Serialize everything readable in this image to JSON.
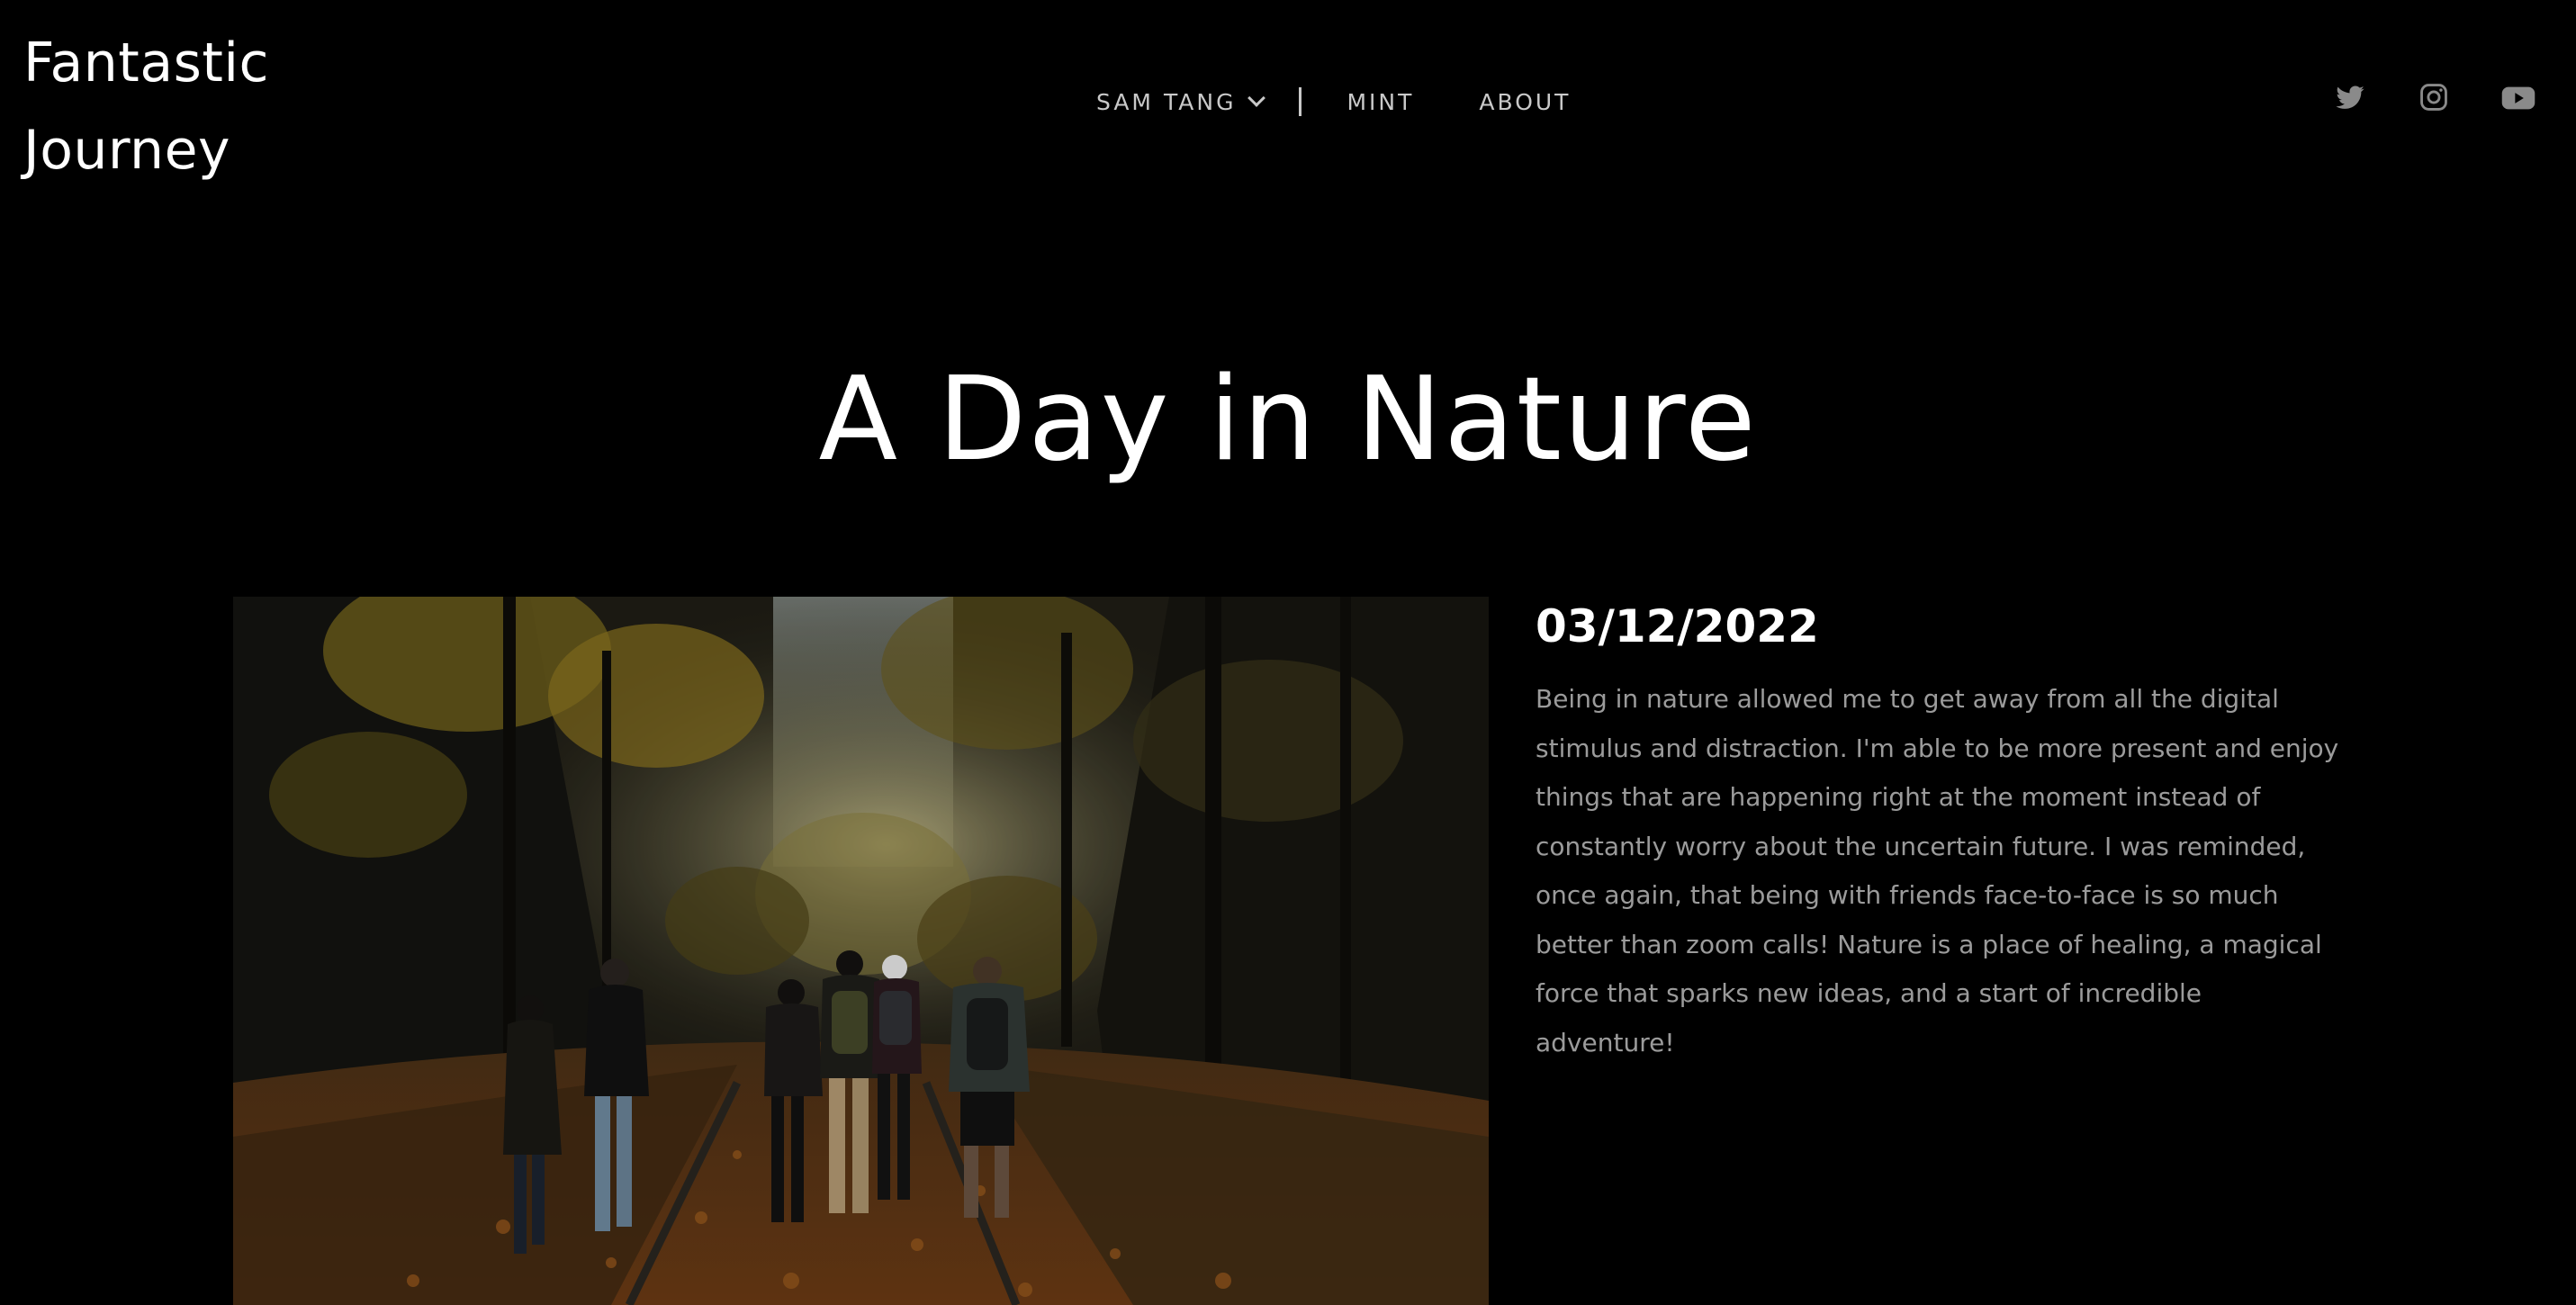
{
  "header": {
    "logo_line1": "Fantastic",
    "logo_line2": "Journey"
  },
  "nav": {
    "items": [
      {
        "label": "SAM TANG",
        "has_dropdown": true
      },
      {
        "label": "MINT"
      },
      {
        "label": "ABOUT"
      }
    ]
  },
  "social": {
    "icons": [
      "twitter-icon",
      "instagram-icon",
      "youtube-icon"
    ],
    "color": "#8a8a8a"
  },
  "post": {
    "title": "A Day in Nature",
    "date": "03/12/2022",
    "body": "Being in nature allowed me to get away from all the digital stimulus and distraction. I'm able to be more present and enjoy things that are happening right at the moment instead of constantly worry about the uncertain future. I was reminded, once again, that being with friends face-to-face is so much better than zoom calls! Nature is a place of healing, a magical force that sparks new ideas, and a start of incredible adventure!",
    "image_subject": "Group of friends hiking along a leaf-covered railway track through an autumn forest"
  },
  "colors": {
    "background": "#000000",
    "text_primary": "#ffffff",
    "text_secondary": "#9b9b9b",
    "nav_text": "#c9c9c9"
  }
}
